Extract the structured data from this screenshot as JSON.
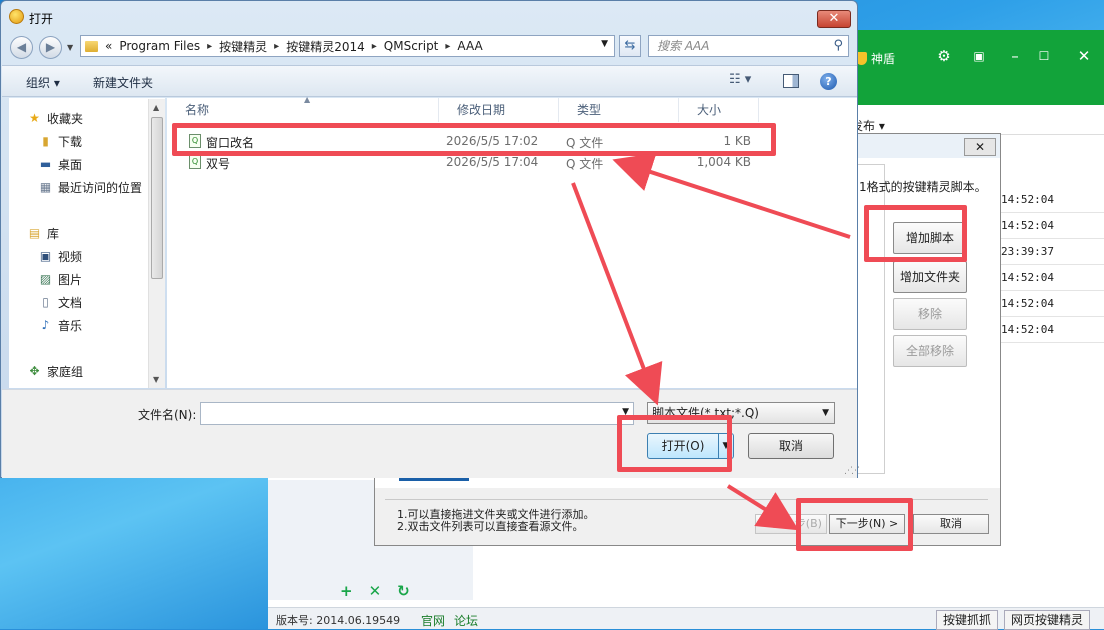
{
  "app": {
    "shield_label": "神盾",
    "menu_publish": "发布 ▾",
    "times": [
      "14:52:04",
      "14:52:04",
      "23:39:37",
      "14:52:04",
      "14:52:04",
      "14:52:04"
    ],
    "version": "版本号: 2014.06.19549",
    "link_official": "官网",
    "link_forum": "论坛",
    "btn_capture": "按键抓抓",
    "btn_web": "网页按键精灵"
  },
  "wizard": {
    "close_icon": "✕",
    "description": "1格式的按键精灵脚本。",
    "btn_add_script": "增加脚本",
    "btn_add_folder": "增加文件夹",
    "btn_remove": "移除",
    "btn_remove_all": "全部移除",
    "tip1": "1.可以直接拖进文件夹或文件进行添加。",
    "tip2": "2.双击文件列表可以直接查看源文件。",
    "btn_prev": "< 上一步(B)",
    "btn_next": "下一步(N) >",
    "btn_cancel": "取消"
  },
  "dialog": {
    "title": "打开",
    "close_icon": "✕",
    "breadcrumb": {
      "lead": "«",
      "parts": [
        "Program Files",
        "按键精灵",
        "按键精灵2014",
        "QMScript",
        "AAA"
      ]
    },
    "search_placeholder": "搜索 AAA",
    "toolbar": {
      "organize": "组织 ▾",
      "new_folder": "新建文件夹",
      "help": "?"
    },
    "nav": {
      "favorites": "收藏夹",
      "download": "下载",
      "desktop": "桌面",
      "recent": "最近访问的位置",
      "library": "库",
      "video": "视频",
      "pictures": "图片",
      "documents": "文档",
      "music": "音乐",
      "homegroup": "家庭组"
    },
    "columns": {
      "name": "名称",
      "date": "修改日期",
      "type": "类型",
      "size": "大小"
    },
    "files": [
      {
        "name": "窗口改名",
        "date": "2026/5/5 17:02",
        "type": "Q 文件",
        "size": "1 KB"
      },
      {
        "name": "双号",
        "date": "2026/5/5 17:04",
        "type": "Q 文件",
        "size": "1,004 KB"
      }
    ],
    "filename_label": "文件名(N):",
    "filename_value": "",
    "filter": "脚本文件(*.txt;*.Q)",
    "btn_open": "打开(O)",
    "btn_cancel": "取消"
  },
  "colors": {
    "highlight": "#ef4b55",
    "app_green": "#12a33a"
  }
}
